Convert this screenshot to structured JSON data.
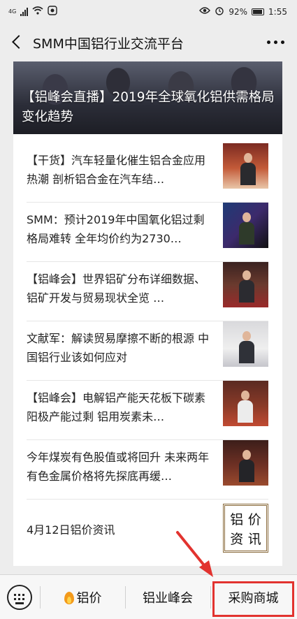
{
  "status_bar": {
    "left_network": "4G",
    "battery": "92%",
    "time": "1:55"
  },
  "nav": {
    "title": "SMM中国铝行业交流平台"
  },
  "hero": {
    "title": "【铝峰会直播】2019年全球氧化铝供需格局变化趋势"
  },
  "articles": [
    {
      "title": "【干货】汽车轻量化催生铝合金应用热潮 剖析铝合金在汽车结…"
    },
    {
      "title": "SMM：预计2019年中国氧化铝过剩格局难转 全年均价约为2730…"
    },
    {
      "title": "【铝峰会】世界铝矿分布详细数据、铝矿开发与贸易现状全览 …"
    },
    {
      "title": "文献军：解读贸易摩擦不断的根源 中国铝行业该如何应对"
    },
    {
      "title": "【铝峰会】电解铝产能天花板下碳素阳极产能过剩 铝用炭素未…"
    },
    {
      "title": "今年煤炭有色股值或将回升 未来两年有色金属价格将先探底再缓…"
    }
  ],
  "price_item": {
    "title": "4月12日铝价资讯",
    "box_chars": [
      "铝",
      "价",
      "资",
      "讯"
    ]
  },
  "bottom_menu": {
    "items": [
      "铝价",
      "铝业峰会",
      "采购商城"
    ]
  },
  "colors": {
    "highlight": "#e2332f",
    "flame": "#f39a1b"
  }
}
